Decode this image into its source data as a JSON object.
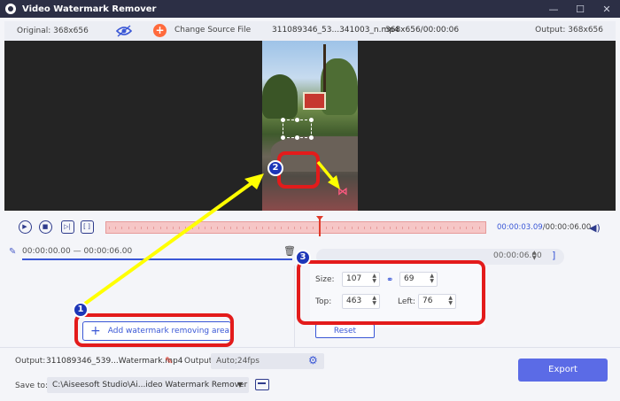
{
  "window": {
    "title": "Video Watermark Remover",
    "controls": [
      "—",
      "☐",
      "✕"
    ]
  },
  "infobar": {
    "original": "Original: 368x656",
    "change_source": "Change Source File",
    "file_name": "311089346_53...341003_n.mp4",
    "file_meta": "368x656/00:00:06",
    "output": "Output: 368x656"
  },
  "playback": {
    "current_time": "00:00:03.09",
    "total_time": "/00:00:06.00",
    "progress": 0.55
  },
  "segment": {
    "time_range": "00:00:00.00 — 00:00:06.00",
    "right_time": "00:00:06.00",
    "right_bracket": "]"
  },
  "area": {
    "add_button": "Add watermark removing area",
    "size_label": "Size:",
    "width": "107",
    "height": "69",
    "top_label": "Top:",
    "top": "463",
    "left_label": "Left:",
    "left": "76",
    "reset": "Reset"
  },
  "bottom": {
    "output_label": "Output:",
    "output_file": "311089346_539...Watermark.mp4",
    "output2_label": "Output:",
    "output_format": "Auto;24fps",
    "save_label": "Save to:",
    "save_path": "C:\\Aiseesoft Studio\\Ai...ideo Watermark Remover",
    "export": "Export"
  },
  "annotations": {
    "badge1": "1",
    "badge2": "2",
    "badge3": "3"
  },
  "colors": {
    "highlight": "#e31b1b",
    "arrow": "#ffff00",
    "accent": "#3a57d6",
    "badge": "#1d36b8"
  }
}
